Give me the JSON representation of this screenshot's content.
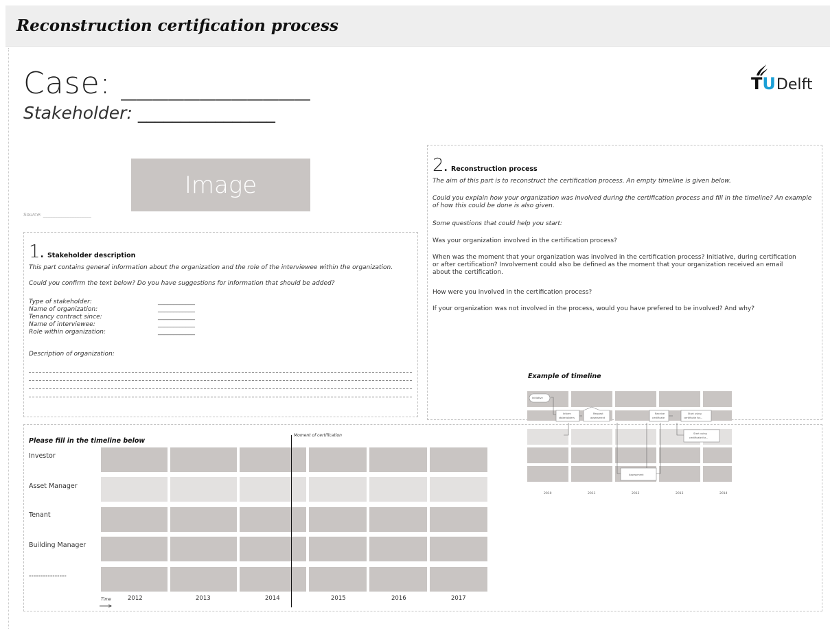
{
  "header": {
    "title": "Reconstruction certification process"
  },
  "case": {
    "label": "Case:",
    "blank": "____________"
  },
  "stakeholder": {
    "label": "Stakeholder:",
    "blank": "________________"
  },
  "logo": {
    "tu_t": "T",
    "tu_u": "U",
    "delft": "Delft",
    "brand_color": "#1a9fd6"
  },
  "image_placeholder": {
    "label": "Image",
    "source": "Source: ____________________"
  },
  "section1": {
    "number": "1",
    "dot": ".",
    "title": "Stakeholder description",
    "intro": "This part contains general information about the organization and the role of the interviewee within the organization.",
    "question": "Could you confirm the text below? Do you have suggestions for information that should be added?",
    "fields": [
      {
        "label": "Type of stakeholder:",
        "value": "____________"
      },
      {
        "label": "Name of organization:",
        "value": "____________"
      },
      {
        "label": "Tenancy contract since:",
        "value": "____________"
      },
      {
        "label": "Name of interviewee:",
        "value": "____________"
      },
      {
        "label": "Role within organization:",
        "value": "____________"
      }
    ],
    "description_label": "Description of organization:"
  },
  "section2": {
    "number": "2",
    "dot": ".",
    "title": "Reconstruction process",
    "intro": "The aim of this part is to reconstruct the certification process. An empty timeline is given below.",
    "ask_line1": "Could you explain how your organization was involved during the certification process and fill in the timeline? An example",
    "ask_line2": "of how this could be done is also given.",
    "help": "Some questions that could help you start:",
    "q1": "Was your organization involved in the certification process?",
    "q2_line1": "When was the moment that your organization was involved in the certification process? Initiative, during certification",
    "q2_line2": "or after certification? Involvement could also be defined as the moment that your organization received an email",
    "q2_line3": "about the certification.",
    "q3": "How were you involved in the certification process?",
    "q4": "If your organization was not involved in the process, would you have prefered to be involved? And why?"
  },
  "timeline": {
    "title": "Please fill in the timeline below",
    "moment_label": "Moment of certification",
    "time_label": "Time",
    "rows": [
      "Investor",
      "Asset Manager",
      "Tenant",
      "Building Manager",
      "----------------"
    ],
    "years": [
      "2012",
      "2013",
      "2014",
      "2015",
      "2016",
      "2017"
    ]
  },
  "example": {
    "title": "Example of timeline",
    "boxes": {
      "initiative": "Initiative",
      "inform_1": "Inform",
      "inform_2": "stakeholders",
      "request_1": "Request",
      "request_2": "assessment",
      "receive_1": "Receive",
      "receive_2": "certificate",
      "start1_1": "Start using",
      "start1_2": "certificate for...",
      "start2_1": "Start using",
      "start2_2": "certificate for...",
      "assessment": "Assessment"
    },
    "years": [
      "2010",
      "2011",
      "2012",
      "2013",
      "2014"
    ]
  }
}
